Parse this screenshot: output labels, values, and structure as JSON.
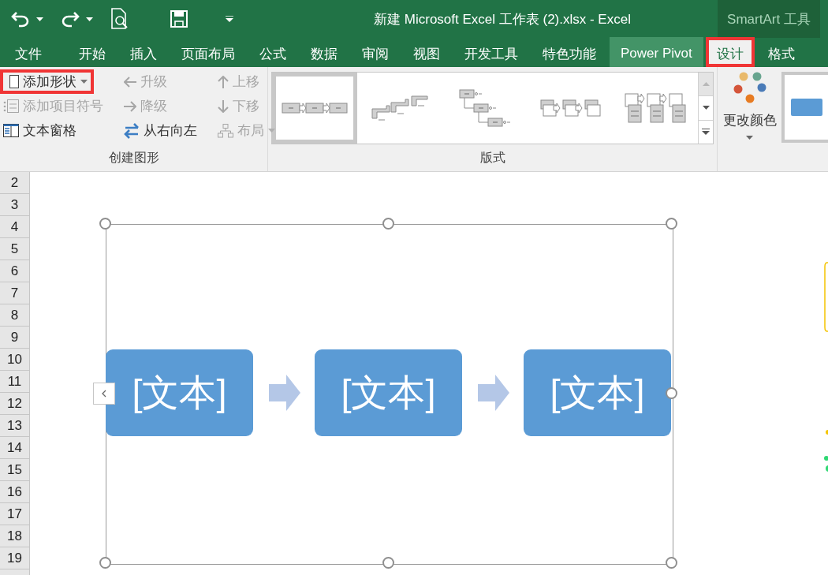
{
  "title_bar": {
    "title": "新建 Microsoft Excel 工作表 (2).xlsx - Excel",
    "context_label": "SmartArt 工具"
  },
  "tabs": [
    {
      "label": "文件",
      "selected": false,
      "highlighted": false,
      "annotated": false
    },
    {
      "label": "开始",
      "selected": false,
      "highlighted": false,
      "annotated": false
    },
    {
      "label": "插入",
      "selected": false,
      "highlighted": false,
      "annotated": false
    },
    {
      "label": "页面布局",
      "selected": false,
      "highlighted": false,
      "annotated": false
    },
    {
      "label": "公式",
      "selected": false,
      "highlighted": false,
      "annotated": false
    },
    {
      "label": "数据",
      "selected": false,
      "highlighted": false,
      "annotated": false
    },
    {
      "label": "审阅",
      "selected": false,
      "highlighted": false,
      "annotated": false
    },
    {
      "label": "视图",
      "selected": false,
      "highlighted": false,
      "annotated": false
    },
    {
      "label": "开发工具",
      "selected": false,
      "highlighted": false,
      "annotated": false
    },
    {
      "label": "特色功能",
      "selected": false,
      "highlighted": false,
      "annotated": false
    },
    {
      "label": "Power Pivot",
      "selected": false,
      "highlighted": true,
      "annotated": false
    },
    {
      "label": "设计",
      "selected": true,
      "highlighted": false,
      "annotated": true
    },
    {
      "label": "格式",
      "selected": false,
      "highlighted": false,
      "annotated": false
    }
  ],
  "create_group": {
    "label": "创建图形",
    "columns": [
      [
        {
          "kind": "add-shape",
          "label": "添加形状",
          "disabled": false,
          "dropdown": true,
          "annotated": true
        },
        {
          "kind": "add-bullet",
          "label": "添加项目符号",
          "disabled": true,
          "dropdown": false,
          "annotated": false
        },
        {
          "kind": "text-pane",
          "label": "文本窗格",
          "disabled": false,
          "dropdown": false,
          "annotated": false
        }
      ],
      [
        {
          "kind": "promote",
          "label": "升级",
          "disabled": true,
          "dropdown": false,
          "annotated": false
        },
        {
          "kind": "demote",
          "label": "降级",
          "disabled": true,
          "dropdown": false,
          "annotated": false
        },
        {
          "kind": "right-to-left",
          "label": "从右向左",
          "disabled": false,
          "dropdown": false,
          "annotated": false
        }
      ],
      [
        {
          "kind": "move-up",
          "label": "上移",
          "disabled": true,
          "dropdown": false,
          "annotated": false
        },
        {
          "kind": "move-down",
          "label": "下移",
          "disabled": true,
          "dropdown": false,
          "annotated": false
        },
        {
          "kind": "layout",
          "label": "布局",
          "disabled": true,
          "dropdown": true,
          "annotated": false
        }
      ]
    ]
  },
  "layouts_group": {
    "label": "版式",
    "layouts": [
      {
        "kind": "basic-process",
        "selected": true
      },
      {
        "kind": "step-up",
        "selected": false
      },
      {
        "kind": "descending",
        "selected": false
      },
      {
        "kind": "sub-steps",
        "selected": false
      },
      {
        "kind": "list-process",
        "selected": false
      }
    ]
  },
  "colors_button": {
    "label": "更改颜色"
  },
  "row_headers": [
    "2",
    "3",
    "4",
    "5",
    "6",
    "7",
    "8",
    "9",
    "10",
    "11",
    "12",
    "13",
    "14",
    "15",
    "16",
    "17",
    "18",
    "19"
  ],
  "smartart": {
    "nodes": [
      {
        "text": "[文本]"
      },
      {
        "text": "[文本]"
      },
      {
        "text": "[文本]"
      }
    ]
  }
}
